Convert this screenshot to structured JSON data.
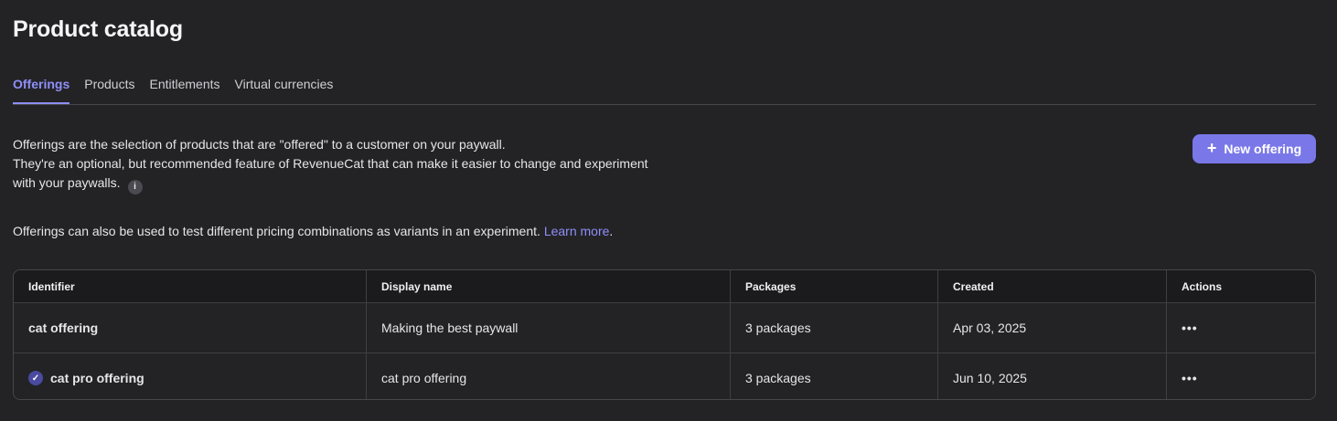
{
  "page": {
    "title": "Product catalog"
  },
  "tabs": [
    {
      "label": "Offerings",
      "active": true
    },
    {
      "label": "Products",
      "active": false
    },
    {
      "label": "Entitlements",
      "active": false
    },
    {
      "label": "Virtual currencies",
      "active": false
    }
  ],
  "description": {
    "line1": "Offerings are the selection of products that are \"offered\" to a customer on your paywall.",
    "line2": "They're an optional, but recommended feature of RevenueCat that can make it easier to change and experiment",
    "line3": "with your paywalls.",
    "info_icon_glyph": "i",
    "experiment_text": "Offerings can also be used to test different pricing combinations as variants in an experiment.",
    "learn_more": "Learn more",
    "period": "."
  },
  "new_offering_button": {
    "label": "New offering",
    "icon": "plus-icon",
    "icon_glyph": "+",
    "color": "#7a78e8"
  },
  "table": {
    "headers": [
      "Identifier",
      "Display name",
      "Packages",
      "Created",
      "Actions"
    ],
    "rows": [
      {
        "identifier": "cat offering",
        "display_name": "Making the best paywall",
        "packages": "3 packages",
        "created": "Apr 03, 2025",
        "actions": "•••",
        "current": false
      },
      {
        "identifier": "cat pro offering",
        "display_name": "cat pro offering",
        "packages": "3 packages",
        "created": "Jun 10, 2025",
        "actions": "•••",
        "current": true,
        "current_icon_glyph": "✓"
      }
    ]
  },
  "colors": {
    "accent": "#8f8ff8",
    "background": "#232326",
    "header_bg": "#1b1b1e"
  }
}
